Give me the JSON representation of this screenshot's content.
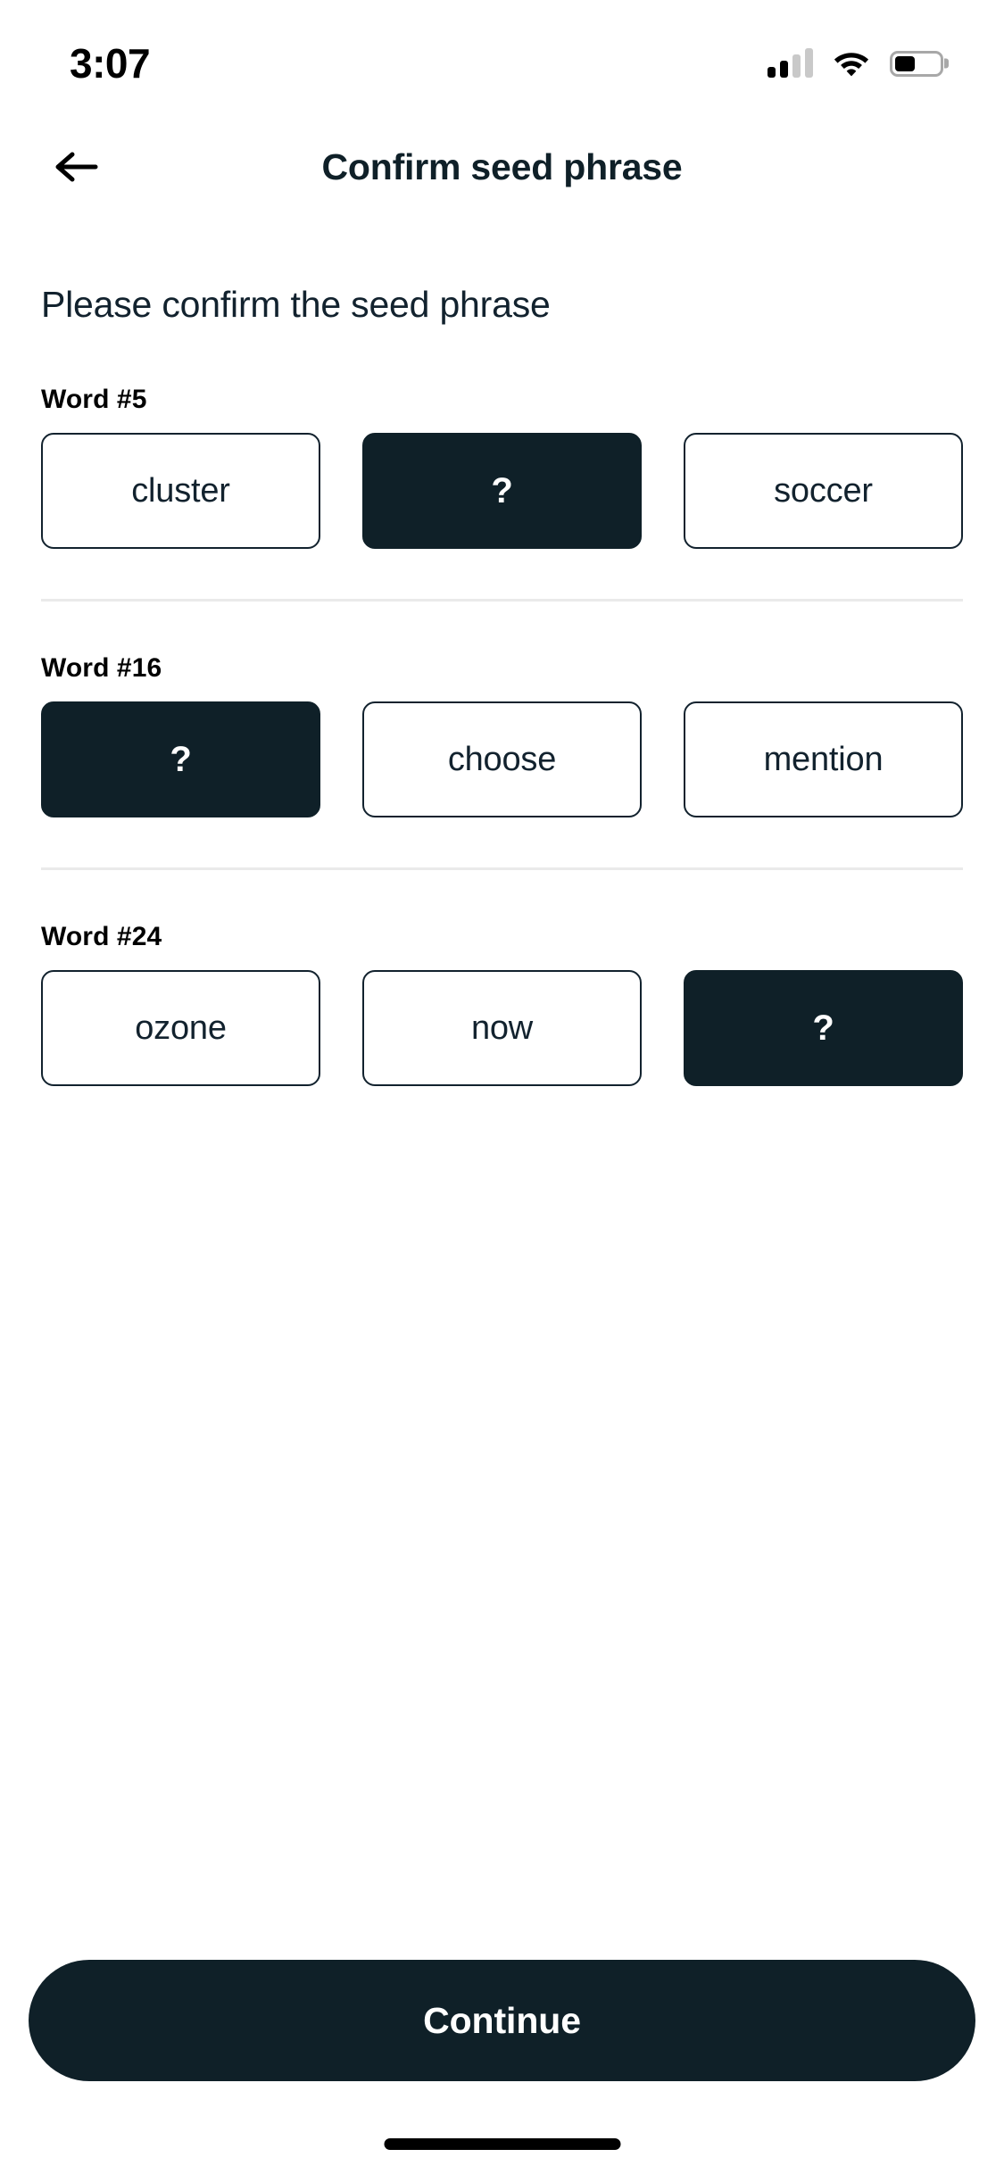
{
  "status_bar": {
    "time": "3:07",
    "cellular_icon": "cellular-signal-icon",
    "cellular_bars_filled": 2,
    "cellular_bars_total": 4,
    "wifi_icon": "wifi-icon",
    "battery_icon": "battery-icon",
    "battery_percent": 45
  },
  "header": {
    "back_icon": "arrow-left-icon",
    "title": "Confirm seed phrase"
  },
  "main": {
    "subtitle": "Please confirm the seed phrase",
    "groups": [
      {
        "label": "Word #5",
        "options": [
          {
            "text": "cluster",
            "selected": false
          },
          {
            "text": "?",
            "selected": true
          },
          {
            "text": "soccer",
            "selected": false
          }
        ]
      },
      {
        "label": "Word #16",
        "options": [
          {
            "text": "?",
            "selected": true
          },
          {
            "text": "choose",
            "selected": false
          },
          {
            "text": "mention",
            "selected": false
          }
        ]
      },
      {
        "label": "Word #24",
        "options": [
          {
            "text": "ozone",
            "selected": false
          },
          {
            "text": "now",
            "selected": false
          },
          {
            "text": "?",
            "selected": true
          }
        ]
      }
    ]
  },
  "footer": {
    "continue_label": "Continue",
    "home_indicator": "home-indicator"
  },
  "colors": {
    "accent_dark": "#0f2028",
    "text_dark": "#12222e",
    "divider": "#eaeaea",
    "background": "#ffffff",
    "on_accent": "#ffffff"
  }
}
